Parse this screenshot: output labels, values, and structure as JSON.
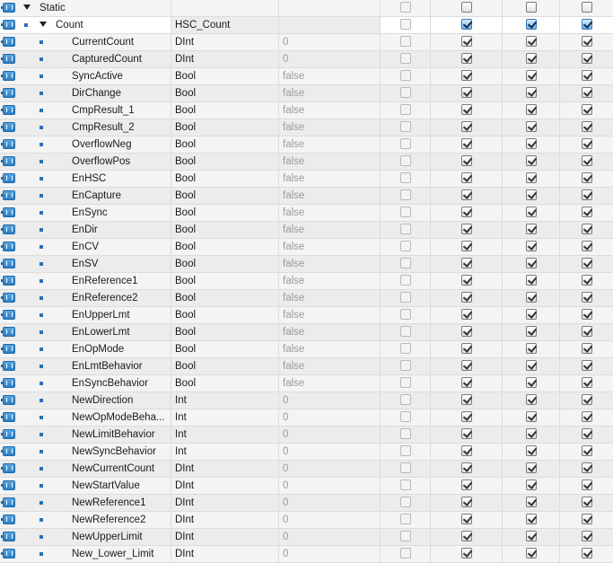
{
  "static_row": {
    "label": "Static"
  },
  "count_row": {
    "label": "Count",
    "type": "HSC_Count"
  },
  "members": [
    {
      "name": "CurrentCount",
      "type": "DInt",
      "value": "0"
    },
    {
      "name": "CapturedCount",
      "type": "DInt",
      "value": "0"
    },
    {
      "name": "SyncActive",
      "type": "Bool",
      "value": "false"
    },
    {
      "name": "DirChange",
      "type": "Bool",
      "value": "false"
    },
    {
      "name": "CmpResult_1",
      "type": "Bool",
      "value": "false"
    },
    {
      "name": "CmpResult_2",
      "type": "Bool",
      "value": "false"
    },
    {
      "name": "OverflowNeg",
      "type": "Bool",
      "value": "false"
    },
    {
      "name": "OverflowPos",
      "type": "Bool",
      "value": "false"
    },
    {
      "name": "EnHSC",
      "type": "Bool",
      "value": "false"
    },
    {
      "name": "EnCapture",
      "type": "Bool",
      "value": "false"
    },
    {
      "name": "EnSync",
      "type": "Bool",
      "value": "false"
    },
    {
      "name": "EnDir",
      "type": "Bool",
      "value": "false"
    },
    {
      "name": "EnCV",
      "type": "Bool",
      "value": "false"
    },
    {
      "name": "EnSV",
      "type": "Bool",
      "value": "false"
    },
    {
      "name": "EnReference1",
      "type": "Bool",
      "value": "false"
    },
    {
      "name": "EnReference2",
      "type": "Bool",
      "value": "false"
    },
    {
      "name": "EnUpperLmt",
      "type": "Bool",
      "value": "false"
    },
    {
      "name": "EnLowerLmt",
      "type": "Bool",
      "value": "false"
    },
    {
      "name": "EnOpMode",
      "type": "Bool",
      "value": "false"
    },
    {
      "name": "EnLmtBehavior",
      "type": "Bool",
      "value": "false"
    },
    {
      "name": "EnSyncBehavior",
      "type": "Bool",
      "value": "false"
    },
    {
      "name": "NewDirection",
      "type": "Int",
      "value": "0"
    },
    {
      "name": "NewOpModeBeha...",
      "type": "Int",
      "value": "0"
    },
    {
      "name": "NewLimitBehavior",
      "type": "Int",
      "value": "0"
    },
    {
      "name": "NewSyncBehavior",
      "type": "Int",
      "value": "0"
    },
    {
      "name": "NewCurrentCount",
      "type": "DInt",
      "value": "0"
    },
    {
      "name": "NewStartValue",
      "type": "DInt",
      "value": "0"
    },
    {
      "name": "NewReference1",
      "type": "DInt",
      "value": "0"
    },
    {
      "name": "NewReference2",
      "type": "DInt",
      "value": "0"
    },
    {
      "name": "NewUpperLimit",
      "type": "DInt",
      "value": "0"
    },
    {
      "name": "New_Lower_Limit",
      "type": "DInt",
      "value": "0"
    }
  ],
  "checkbox_states": {
    "static": [
      false,
      false,
      false,
      false
    ],
    "count": [
      false,
      true,
      true,
      true
    ],
    "member": [
      false,
      true,
      true,
      true
    ]
  },
  "icons": {
    "member": "db-member-icon",
    "expand": "expanded-triangle-icon",
    "bullet": "member-bullet-icon"
  }
}
